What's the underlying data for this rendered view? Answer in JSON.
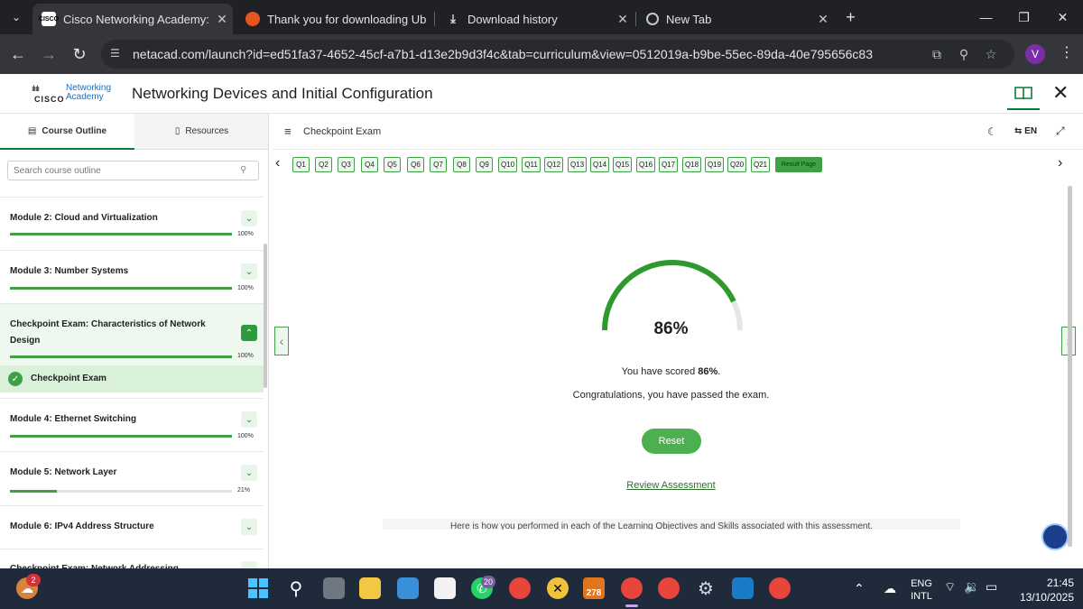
{
  "browser": {
    "tabs": [
      {
        "title": "Cisco Networking Academy: Ne",
        "favicon": "CISCO",
        "active": true
      },
      {
        "title": "Thank you for downloading Ub",
        "active": false
      },
      {
        "title": "Download history",
        "active": false
      },
      {
        "title": "New Tab",
        "active": false
      }
    ],
    "url": "netacad.com/launch?id=ed51fa37-4652-45cf-a7b1-d13e2b9d3f4c&tab=curriculum&view=0512019a-b9be-55ec-89da-40e795656c83",
    "profile_initial": "V"
  },
  "app": {
    "logo_cisco": "CISCO",
    "logo_na_line1": "Networking",
    "logo_na_line2": "Academy",
    "course_title": "Networking Devices and Initial Configuration"
  },
  "sidebar": {
    "tabs": {
      "outline": "Course Outline",
      "resources": "Resources"
    },
    "search_placeholder": "Search course outline",
    "modules": [
      {
        "name": "Module 2: Cloud and Virtualization",
        "progress": 100,
        "pct_label": "100%"
      },
      {
        "name": "Module 3: Number Systems",
        "progress": 100,
        "pct_label": "100%"
      },
      {
        "name_line1": "Checkpoint Exam: Characteristics of Network",
        "name_line2": "Design",
        "progress": 100,
        "pct_label": "100%",
        "expanded": true
      },
      {
        "name": "Module 4: Ethernet Switching",
        "progress": 100,
        "pct_label": "100%"
      },
      {
        "name": "Module 5: Network Layer",
        "progress": 21,
        "pct_label": "21%"
      },
      {
        "name": "Module 6: IPv4 Address Structure"
      },
      {
        "name": "Checkpoint Exam: Network Addressing"
      }
    ],
    "active_item": "Checkpoint Exam"
  },
  "exam": {
    "header_title": "Checkpoint Exam",
    "lang": "EN",
    "questions": [
      "Q1",
      "Q2",
      "Q3",
      "Q4",
      "Q5",
      "Q6",
      "Q7",
      "Q8",
      "Q9",
      "Q10",
      "Q11",
      "Q12",
      "Q13",
      "Q14",
      "Q15",
      "Q16",
      "Q17",
      "Q18",
      "Q19",
      "Q20",
      "Q21"
    ],
    "result_label": "Result Page",
    "score": 86,
    "score_label": "86%",
    "scored_prefix": "You have scored ",
    "scored_value": "86%",
    "scored_suffix": ".",
    "congrats": "Congratulations, you have passed the exam.",
    "reset_label": "Reset",
    "review_label": "Review Assessment",
    "perf_text": "Here is how you performed in each of the Learning Objectives and Skills associated with this assessment.",
    "accent_color": "#2e9a2e"
  },
  "taskbar": {
    "widgets_badge": "2",
    "whatsapp_badge": "20",
    "counter_label": "278",
    "lang_line1": "ENG",
    "lang_line2": "INTL",
    "time": "21:45",
    "date": "13/10/2025"
  }
}
